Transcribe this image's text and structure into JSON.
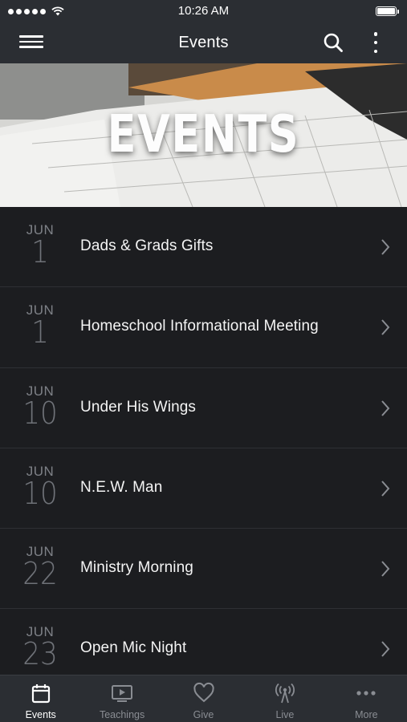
{
  "status_bar": {
    "time": "10:26 AM"
  },
  "nav": {
    "title": "Events"
  },
  "hero": {
    "text": "EVENTS"
  },
  "events": [
    {
      "month": "JUN",
      "day": "1",
      "title": "Dads & Grads Gifts"
    },
    {
      "month": "JUN",
      "day": "1",
      "title": "Homeschool Informational Meeting"
    },
    {
      "month": "JUN",
      "day": "10",
      "title": "Under His Wings"
    },
    {
      "month": "JUN",
      "day": "10",
      "title": "N.E.W. Man"
    },
    {
      "month": "JUN",
      "day": "22",
      "title": "Ministry Morning"
    },
    {
      "month": "JUN",
      "day": "23",
      "title": "Open Mic Night"
    }
  ],
  "tabs": [
    {
      "label": "Events",
      "icon": "calendar-icon",
      "active": true
    },
    {
      "label": "Teachings",
      "icon": "tv-play-icon",
      "active": false
    },
    {
      "label": "Give",
      "icon": "heart-icon",
      "active": false
    },
    {
      "label": "Live",
      "icon": "broadcast-icon",
      "active": false
    },
    {
      "label": "More",
      "icon": "more-dots-icon",
      "active": false
    }
  ],
  "colors": {
    "bar_bg": "#2b2e33",
    "list_bg": "#1c1d20",
    "date_text": "#7d8086",
    "inactive_tab": "#8a8d93"
  }
}
